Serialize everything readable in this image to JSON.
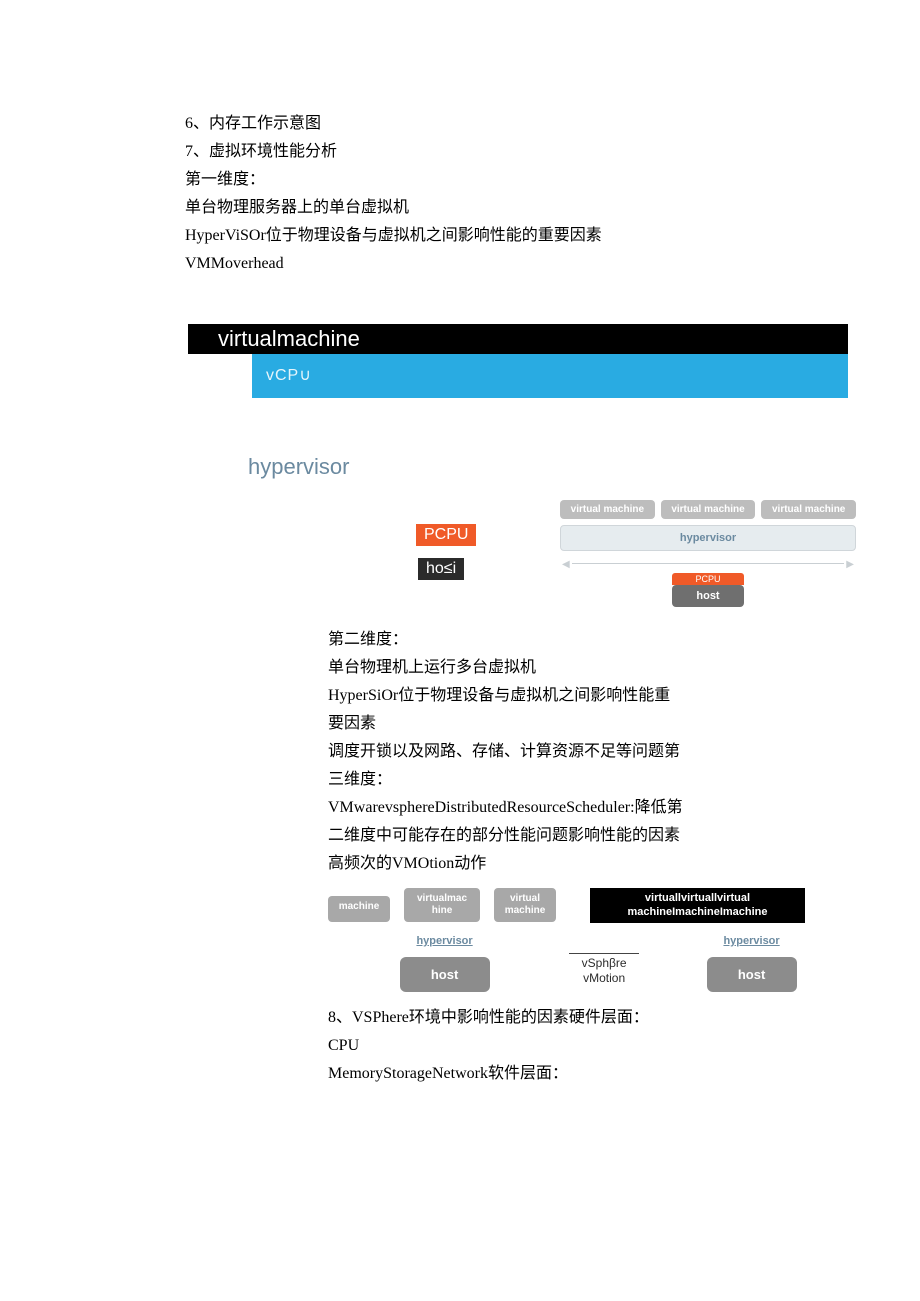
{
  "intro": {
    "line1": "6、内存工作示意图",
    "line2": "7、虚拟环境性能分析",
    "line3": "第一维度：",
    "line4": "单台物理服务器上的单台虚拟机",
    "line5": "HyperViSOr位于物理设备与虚拟机之间影响性能的重要因素",
    "line6": "VMMoverhead"
  },
  "diagram1": {
    "vm_title": "virtualmachine",
    "vcpu": "vCP∪",
    "hypervisor": "hypervisor",
    "pcpu": "PCPU",
    "host": "ho≤i"
  },
  "diagram1_right": {
    "vm1": "virtual machine",
    "vm2": "virtual machine",
    "vm3": "virtual machine",
    "hypervisor": "hypervisor",
    "pcpu": "PCPU",
    "host": "host"
  },
  "body": {
    "line1": "第二维度：",
    "line2": "单台物理机上运行多台虚拟机",
    "line3": "HyperSiOr位于物理设备与虚拟机之间影响性能重",
    "line4": "要因素",
    "line5": "调度开锁以及网路、存储、计算资源不足等问题第",
    "line6": "三维度：",
    "line7": "VMwarevsphereDistributedResourceScheduler:降低第",
    "line8": "二维度中可能存在的部分性能问题影响性能的因素",
    "line9": "高频次的VMOtion动作"
  },
  "diagram2": {
    "left_vms": {
      "vm1": "machine",
      "vm2": "virtualmac\nhine",
      "vm3": "virtual\nmachine"
    },
    "right_vms": "virtuallvirtuallvirtual\nmachineImachineImachine",
    "hypervisor": "hypervisor",
    "host": "host",
    "vmotion": "vSphβre\nvMotion"
  },
  "footer": {
    "line1": "8、VSPhere环境中影响性能的因素硬件层面：",
    "line2": "CPU",
    "line3": "MemoryStorageNetwork软件层面："
  }
}
